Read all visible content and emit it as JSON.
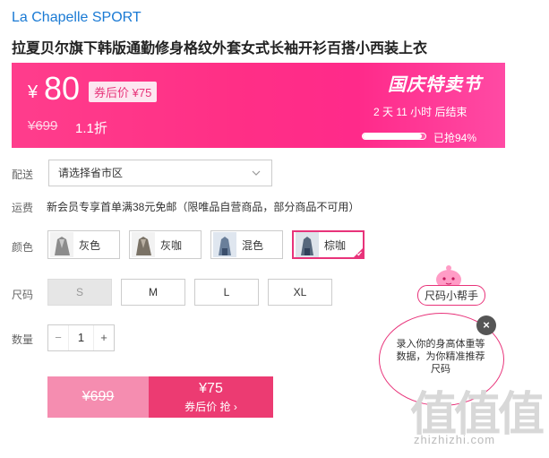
{
  "brand": "La Chapelle SPORT",
  "title": "拉夏贝尔旗下韩版通勤修身格纹外套女式长袖开衫百搭小西装上衣",
  "banner": {
    "currency": "¥",
    "price": "80",
    "coupon_tag": "券后价 ¥75",
    "original_price": "¥699",
    "discount": "1.1折",
    "festival": "国庆特卖节",
    "countdown": "2 天 11 小时 后结束",
    "sold_percent": 94,
    "sold_text": "已抢94%",
    "colors": {
      "accent": "#ff2f86",
      "coupon_text": "#e8337a"
    }
  },
  "delivery": {
    "label": "配送",
    "placeholder": "请选择省市区"
  },
  "shipping": {
    "label": "运费",
    "text": "新会员专享首单满38元免邮（限唯品自营商品，部分商品不可用）"
  },
  "colors": {
    "label": "颜色",
    "options": [
      {
        "name": "灰色",
        "selected": false
      },
      {
        "name": "灰咖",
        "selected": false
      },
      {
        "name": "混色",
        "selected": false
      },
      {
        "name": "棕咖",
        "selected": true
      }
    ]
  },
  "sizes": {
    "label": "尺码",
    "options": [
      {
        "name": "S",
        "disabled": true
      },
      {
        "name": "M",
        "disabled": false
      },
      {
        "name": "L",
        "disabled": false
      },
      {
        "name": "XL",
        "disabled": false
      }
    ]
  },
  "quantity": {
    "label": "数量",
    "value": "1",
    "minus": "−",
    "plus": "+"
  },
  "buy": {
    "original": "¥699",
    "price": "¥75",
    "action": "券后价 抢 ›"
  },
  "helper": {
    "tag": "尺码小帮手",
    "bubble": "录入你的身高体重等数据，为你精准推荐尺码",
    "close": "×"
  },
  "watermark": {
    "glyphs": "值值值",
    "url": "zhizhizhi.com"
  }
}
